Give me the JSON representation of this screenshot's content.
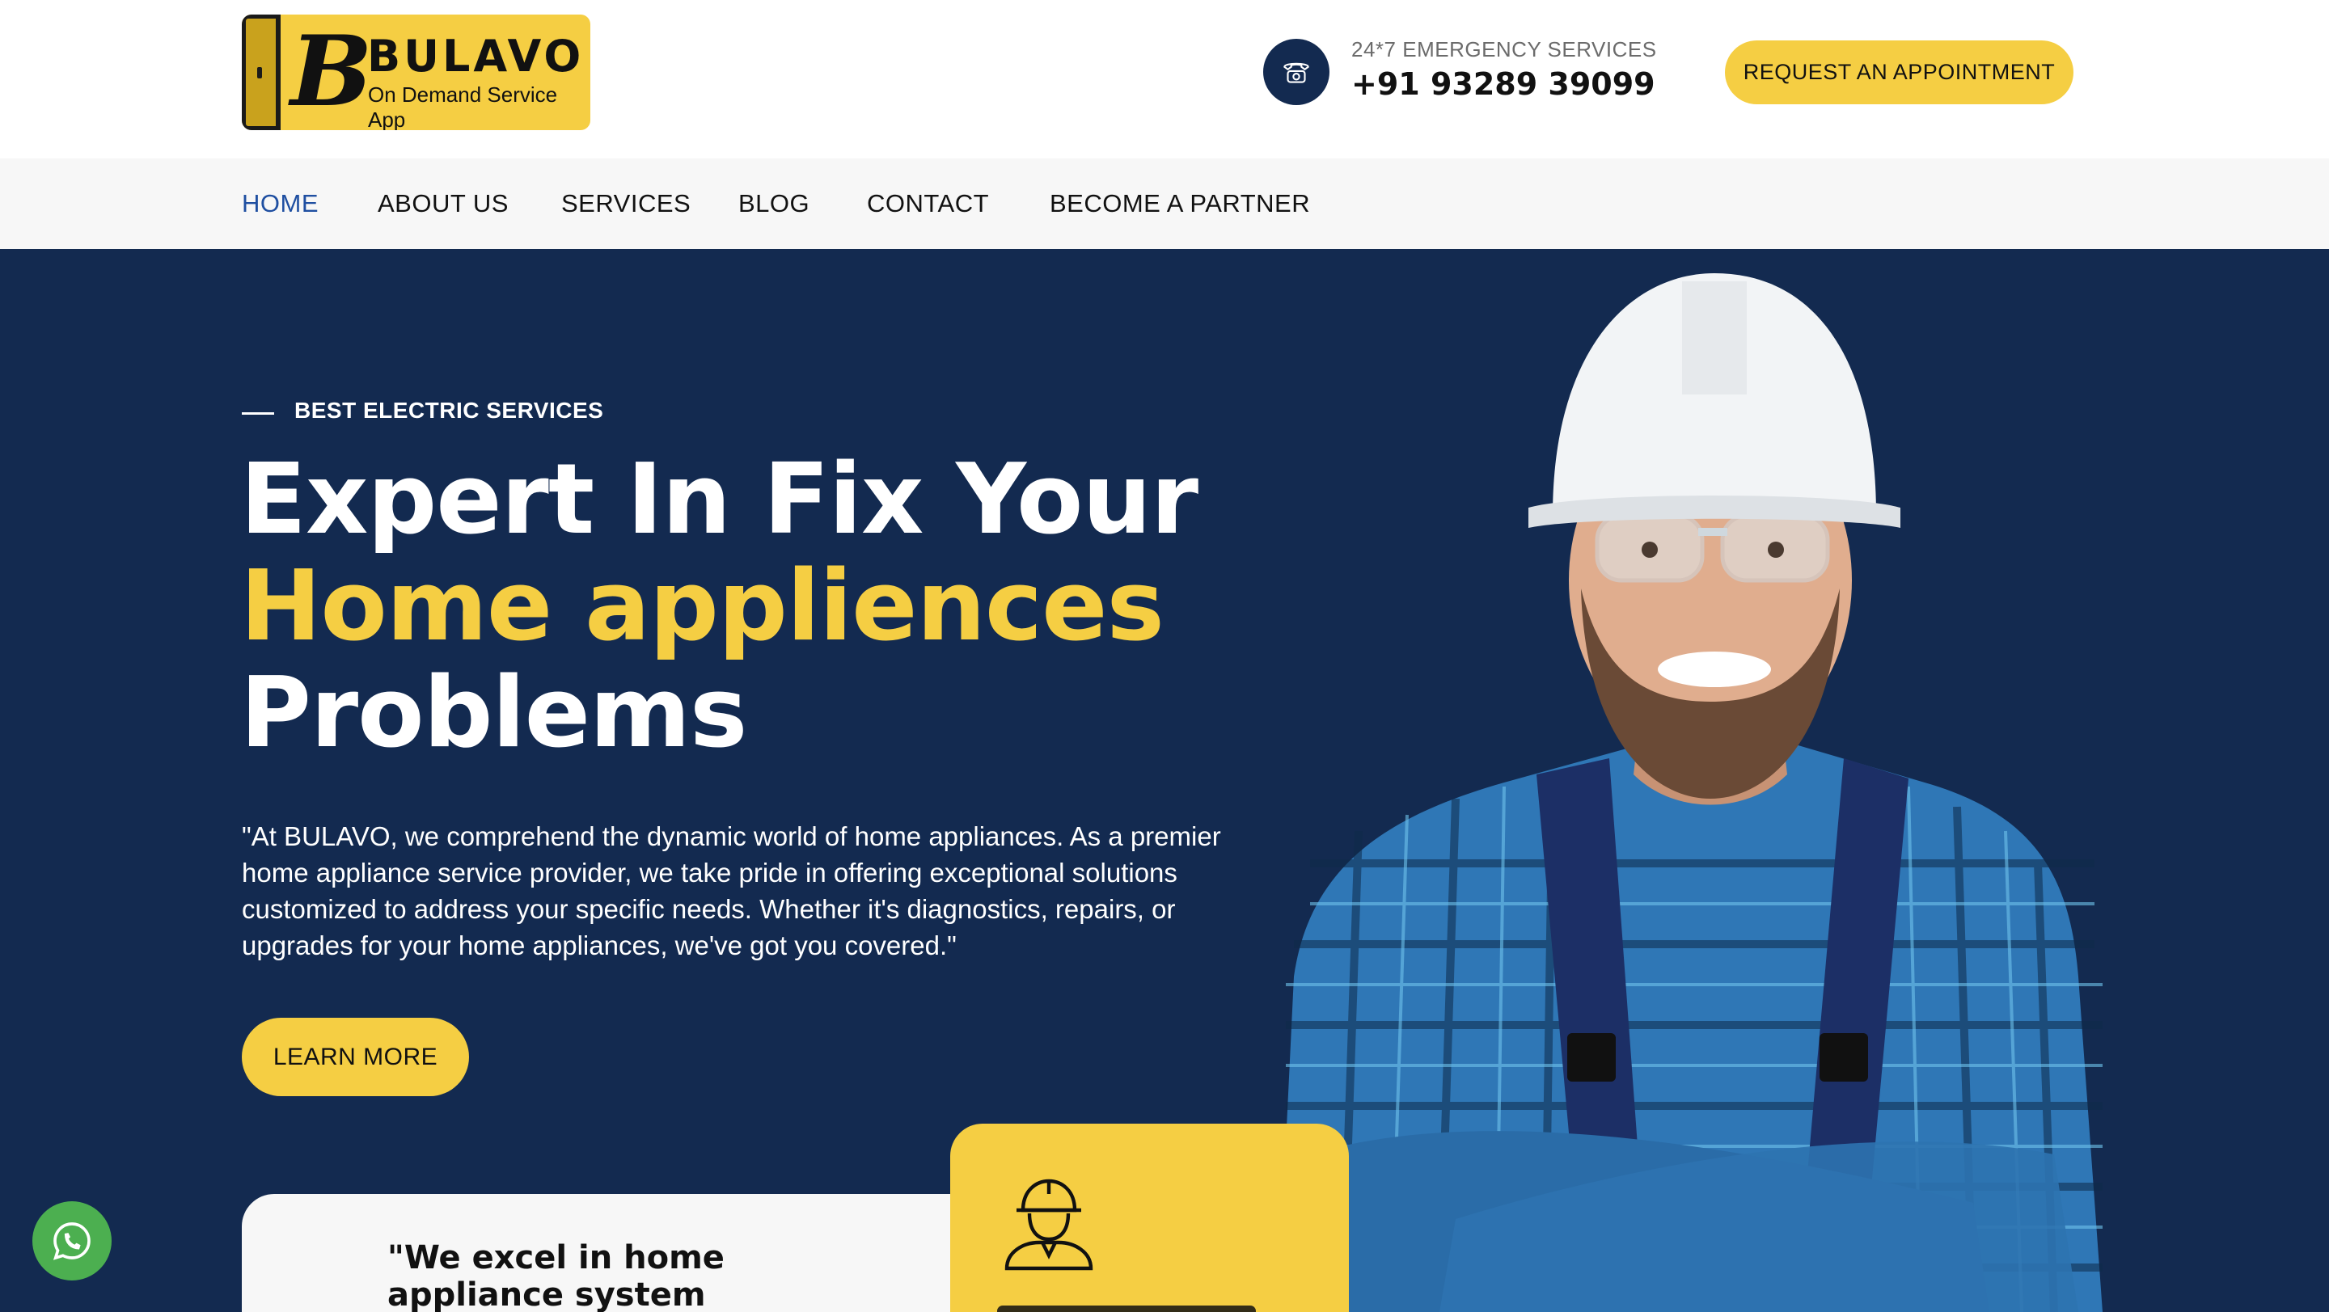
{
  "brand": {
    "letter": "B",
    "name": "BULAVO",
    "tagline": "On Demand Service App",
    "yellow": "#f5ce43",
    "navy": "#132a50",
    "active_nav": "#1f4fa1"
  },
  "header": {
    "phone_icon": "telephone-icon",
    "emergency_label": "24*7 EMERGENCY SERVICES",
    "emergency_number": "+91 93289 39099",
    "cta_label": "REQUEST AN APPOINTMENT"
  },
  "nav": {
    "items": [
      {
        "label": "HOME"
      },
      {
        "label": "ABOUT US"
      },
      {
        "label": "SERVICES"
      },
      {
        "label": "BLOG"
      },
      {
        "label": "CONTACT"
      },
      {
        "label": "BECOME A PARTNER"
      }
    ]
  },
  "hero": {
    "eyebrow": "BEST ELECTRIC SERVICES",
    "headline_line1": "Expert In Fix Your",
    "headline_line2": "Home appliences",
    "headline_line3": "Problems",
    "body": "\"At BULAVO, we comprehend the dynamic world of home appliances. As a premier home appliance service provider, we take pride in offering exceptional solutions customized to address your specific needs. Whether it's diagnostics, repairs, or upgrades for your home appliances, we've got you covered.\"",
    "cta_label": "LEARN MORE"
  },
  "cards": {
    "quote_text": "\"We excel in home appliance system installation, support,",
    "quote_icon": "quote-icon",
    "worker_icon": "worker-helmet-icon"
  },
  "floating": {
    "whatsapp_icon": "whatsapp-icon"
  }
}
